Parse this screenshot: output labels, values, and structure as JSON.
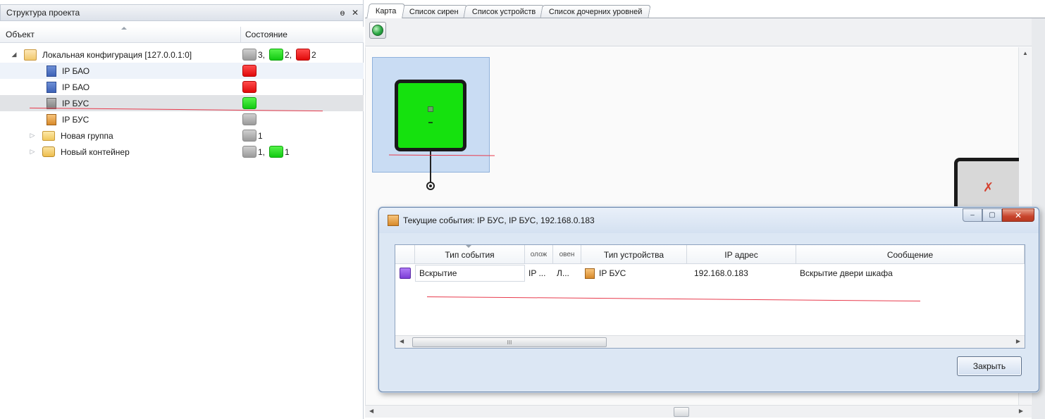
{
  "project_panel": {
    "title": "Структура проекта",
    "pin_glyph": "ɵ",
    "close_glyph": "✕",
    "columns": {
      "object": "Объект",
      "state": "Состояние"
    },
    "rows": [
      {
        "label": "Локальная конфигурация [127.0.0.1:0]",
        "counts": [
          "3,",
          "2,",
          "2"
        ]
      },
      {
        "label": "IP БАО"
      },
      {
        "label": "IP БАО"
      },
      {
        "label": "IP БУС"
      },
      {
        "label": "IP БУС"
      },
      {
        "label": "Новая группа",
        "counts": [
          "1"
        ]
      },
      {
        "label": "Новый контейнер",
        "counts": [
          "1,",
          "1"
        ]
      }
    ]
  },
  "tabs": [
    "Карта",
    "Список сирен",
    "Список устройств",
    "Список дочерних уровней"
  ],
  "dialog": {
    "title": "Текущие события: IP БУС, IP БУС, 192.168.0.183",
    "buttons": {
      "minimize": "‒",
      "maximize": "▢",
      "close": "✕"
    },
    "columns": [
      "Тип события",
      "олож",
      "овен",
      "Тип устройства",
      "IP адрес",
      "Сообщение"
    ],
    "row": {
      "event_type": "Вскрытие",
      "col2": "IP ...",
      "col3": "Л...",
      "device_type": "IP БУС",
      "ip": "192.168.0.183",
      "message": "Вскрытие двери шкафа"
    },
    "scroll_thumb": "III",
    "close_label": "Закрыть"
  },
  "colors": {
    "ok": "#15e10e",
    "alarm": "#e00a0a",
    "unknown": "#9a9a9a",
    "event_opening": "#7c3ed6",
    "annotation_line": "#e83b4d"
  },
  "icons": {
    "globe": "globe-icon",
    "device_ok": "device-ok-icon",
    "device_error": "device-error-icon"
  }
}
